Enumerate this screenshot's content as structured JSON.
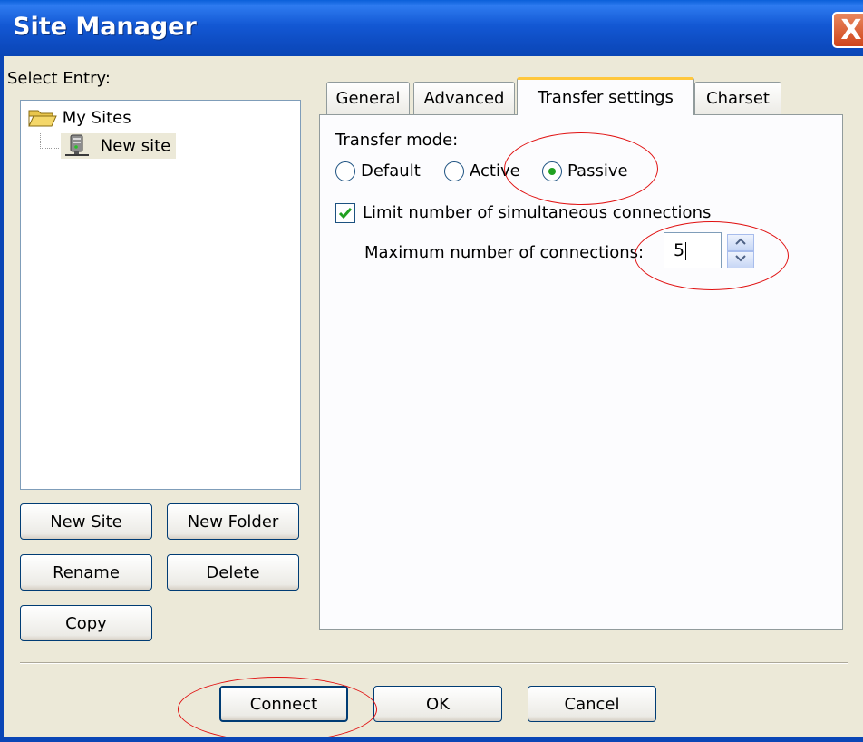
{
  "window": {
    "title": "Site Manager",
    "close_glyph": "X"
  },
  "left_panel": {
    "select_label": "Select Entry:",
    "tree": {
      "folder": {
        "label": "My Sites",
        "icon": "folder-open-icon"
      },
      "site": {
        "label": "New site",
        "icon": "server-icon"
      }
    },
    "buttons": {
      "new_site": "New Site",
      "new_folder": "New Folder",
      "rename": "Rename",
      "delete": "Delete",
      "copy": "Copy"
    }
  },
  "tabs": [
    {
      "label": "General"
    },
    {
      "label": "Advanced"
    },
    {
      "label": "Transfer settings",
      "active": true
    },
    {
      "label": "Charset"
    }
  ],
  "transfer_settings": {
    "mode_label": "Transfer mode:",
    "modes": [
      {
        "label": "Default",
        "selected": false
      },
      {
        "label": "Active",
        "selected": false
      },
      {
        "label": "Passive",
        "selected": true
      }
    ],
    "limit_checkbox": {
      "label": "Limit number of simultaneous connections",
      "checked": true
    },
    "max_connections": {
      "label": "Maximum number of connections:",
      "value": "5"
    }
  },
  "footer": {
    "connect": "Connect",
    "ok": "OK",
    "cancel": "Cancel"
  },
  "colors": {
    "titlebar": "#0a46b6",
    "dialog_bg": "#ece9d8",
    "active_tab_accent": "#ffc73c",
    "annotation_red": "#e01010",
    "check_green": "#21a121"
  }
}
